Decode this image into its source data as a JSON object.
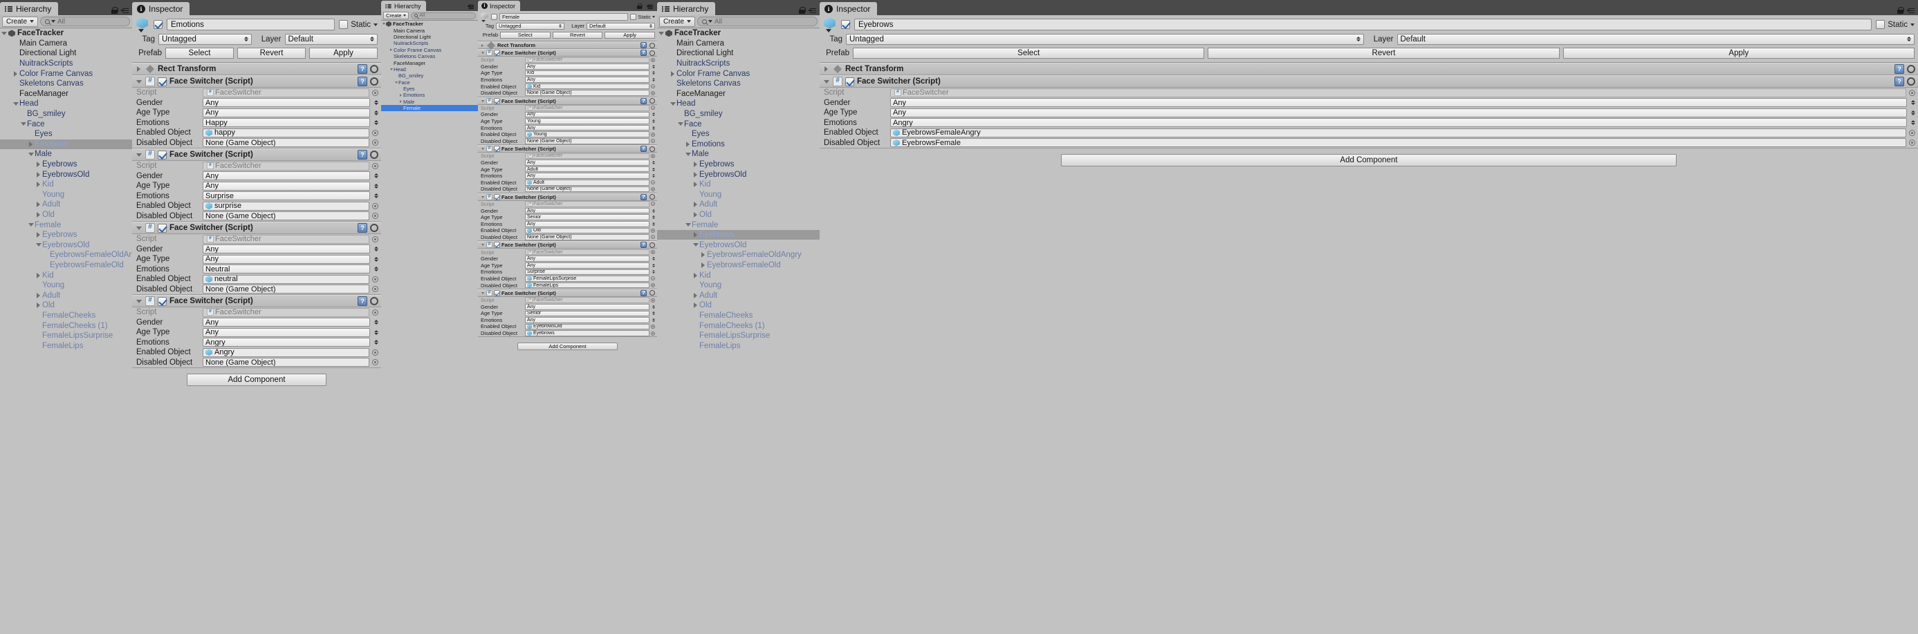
{
  "common": {
    "hierarchy_tab": "Hierarchy",
    "inspector_tab": "Inspector",
    "create_label": "Create",
    "search_placeholder": "All",
    "tag_label": "Tag",
    "layer_label": "Layer",
    "prefab_label": "Prefab",
    "static_label": "Static",
    "select_label": "Select",
    "revert_label": "Revert",
    "apply_label": "Apply",
    "rect_transform": "Rect Transform",
    "face_switcher": "Face Switcher (Script)",
    "add_component": "Add Component",
    "tag_value": "Untagged",
    "layer_value": "Default",
    "script_label": "Script",
    "script_value": "FaceSwitcher",
    "gender_label": "Gender",
    "age_label": "Age Type",
    "emotions_label": "Emotions",
    "enabled_label": "Enabled Object",
    "disabled_label": "Disabled Object",
    "none_game_object": "None (Game Object)",
    "accent_blue": "#3d7ddc",
    "panel_bg": "#c2c2c2"
  },
  "panel1": {
    "hierarchy": {
      "root": "FaceTracker",
      "items": [
        {
          "label": "Main Camera",
          "indent": 1,
          "arrow": "none",
          "style": "black"
        },
        {
          "label": "Directional Light",
          "indent": 1,
          "arrow": "none",
          "style": "black"
        },
        {
          "label": "NuitrackScripts",
          "indent": 1,
          "arrow": "none",
          "style": "blue"
        },
        {
          "label": "Color Frame Canvas",
          "indent": 1,
          "arrow": "right",
          "style": "blue"
        },
        {
          "label": "Skeletons Canvas",
          "indent": 1,
          "arrow": "none",
          "style": "blue"
        },
        {
          "label": "FaceManager",
          "indent": 1,
          "arrow": "none",
          "style": "black"
        },
        {
          "label": "Head",
          "indent": 1,
          "arrow": "down",
          "style": "blue"
        },
        {
          "label": "BG_smiley",
          "indent": 2,
          "arrow": "none",
          "style": "blue"
        },
        {
          "label": "Face",
          "indent": 2,
          "arrow": "down",
          "style": "blue"
        },
        {
          "label": "Eyes",
          "indent": 3,
          "arrow": "none",
          "style": "blue"
        },
        {
          "label": "Emotions",
          "indent": 3,
          "arrow": "right",
          "style": "selected"
        },
        {
          "label": "Male",
          "indent": 3,
          "arrow": "down",
          "style": "blue"
        },
        {
          "label": "Eyebrows",
          "indent": 4,
          "arrow": "right",
          "style": "blue"
        },
        {
          "label": "EyebrowsOld",
          "indent": 4,
          "arrow": "right",
          "style": "blue"
        },
        {
          "label": "Kid",
          "indent": 4,
          "arrow": "right",
          "style": "dim"
        },
        {
          "label": "Young",
          "indent": 4,
          "arrow": "none",
          "style": "dim"
        },
        {
          "label": "Adult",
          "indent": 4,
          "arrow": "right",
          "style": "dim"
        },
        {
          "label": "Old",
          "indent": 4,
          "arrow": "right",
          "style": "dim"
        },
        {
          "label": "Female",
          "indent": 3,
          "arrow": "down",
          "style": "dim"
        },
        {
          "label": "Eyebrows",
          "indent": 4,
          "arrow": "right",
          "style": "dim"
        },
        {
          "label": "EyebrowsOld",
          "indent": 4,
          "arrow": "down",
          "style": "dim"
        },
        {
          "label": "EyebrowsFemaleOldAngry",
          "indent": 5,
          "arrow": "none",
          "style": "dim"
        },
        {
          "label": "EyebrowsFemaleOld",
          "indent": 5,
          "arrow": "none",
          "style": "dim"
        },
        {
          "label": "Kid",
          "indent": 4,
          "arrow": "right",
          "style": "dim"
        },
        {
          "label": "Young",
          "indent": 4,
          "arrow": "none",
          "style": "dim"
        },
        {
          "label": "Adult",
          "indent": 4,
          "arrow": "right",
          "style": "dim"
        },
        {
          "label": "Old",
          "indent": 4,
          "arrow": "right",
          "style": "dim"
        },
        {
          "label": "FemaleCheeks",
          "indent": 4,
          "arrow": "none",
          "style": "dim"
        },
        {
          "label": "FemaleCheeks (1)",
          "indent": 4,
          "arrow": "none",
          "style": "dim"
        },
        {
          "label": "FemaleLipsSurprise",
          "indent": 4,
          "arrow": "none",
          "style": "dim"
        },
        {
          "label": "FemaleLips",
          "indent": 4,
          "arrow": "none",
          "style": "dim"
        }
      ]
    },
    "inspector": {
      "object_name": "Emotions",
      "enabled": true,
      "components": [
        {
          "title": "Face Switcher (Script)",
          "gender": "Any",
          "age": "Any",
          "emotions": "Happy",
          "enabled_object": "happy",
          "enabled_object_has_icon": true,
          "disabled_object": "None (Game Object)",
          "disabled_object_has_icon": false
        },
        {
          "title": "Face Switcher (Script)",
          "gender": "Any",
          "age": "Any",
          "emotions": "Surprise",
          "enabled_object": "surprise",
          "enabled_object_has_icon": true,
          "disabled_object": "None (Game Object)",
          "disabled_object_has_icon": false
        },
        {
          "title": "Face Switcher (Script)",
          "gender": "Any",
          "age": "Any",
          "emotions": "Neutral",
          "enabled_object": "neutral",
          "enabled_object_has_icon": true,
          "disabled_object": "None (Game Object)",
          "disabled_object_has_icon": false
        },
        {
          "title": "Face Switcher (Script)",
          "gender": "Any",
          "age": "Any",
          "emotions": "Angry",
          "enabled_object": "Angry",
          "enabled_object_has_icon": true,
          "disabled_object": "None (Game Object)",
          "disabled_object_has_icon": false
        }
      ]
    }
  },
  "panel2": {
    "hierarchy": {
      "root": "FaceTracker",
      "items": [
        {
          "label": "Main Camera",
          "indent": 1,
          "arrow": "none",
          "style": "black"
        },
        {
          "label": "Directional Light",
          "indent": 1,
          "arrow": "none",
          "style": "black"
        },
        {
          "label": "NuitrackScripts",
          "indent": 1,
          "arrow": "none",
          "style": "blue"
        },
        {
          "label": "Color Frame Canvas",
          "indent": 1,
          "arrow": "right",
          "style": "blue"
        },
        {
          "label": "Skeletons Canvas",
          "indent": 1,
          "arrow": "none",
          "style": "blue"
        },
        {
          "label": "FaceManager",
          "indent": 1,
          "arrow": "none",
          "style": "black"
        },
        {
          "label": "Head",
          "indent": 1,
          "arrow": "down",
          "style": "blue"
        },
        {
          "label": "BG_smiley",
          "indent": 2,
          "arrow": "none",
          "style": "blue"
        },
        {
          "label": "Face",
          "indent": 2,
          "arrow": "down",
          "style": "blue"
        },
        {
          "label": "Eyes",
          "indent": 3,
          "arrow": "none",
          "style": "blue"
        },
        {
          "label": "Emotions",
          "indent": 3,
          "arrow": "right",
          "style": "blue"
        },
        {
          "label": "Male",
          "indent": 3,
          "arrow": "right",
          "style": "blue"
        },
        {
          "label": "Female",
          "indent": 3,
          "arrow": "right",
          "style": "selected-blue"
        }
      ]
    },
    "inspector": {
      "object_name": "Female",
      "enabled": false,
      "components": [
        {
          "title": "Face Switcher (Script)",
          "gender": "Any",
          "age": "Kid",
          "emotions": "Any",
          "enabled_object": "Kid",
          "enabled_object_has_icon": true,
          "disabled_object": "None (Game Object)",
          "disabled_object_has_icon": false
        },
        {
          "title": "Face Switcher (Script)",
          "gender": "Any",
          "age": "Young",
          "emotions": "Any",
          "enabled_object": "Young",
          "enabled_object_has_icon": true,
          "disabled_object": "None (Game Object)",
          "disabled_object_has_icon": false
        },
        {
          "title": "Face Switcher (Script)",
          "gender": "Any",
          "age": "Adult",
          "emotions": "Any",
          "enabled_object": "Adult",
          "enabled_object_has_icon": true,
          "disabled_object": "None (Game Object)",
          "disabled_object_has_icon": false
        },
        {
          "title": "Face Switcher (Script)",
          "gender": "Any",
          "age": "Senior",
          "emotions": "Any",
          "enabled_object": "Old",
          "enabled_object_has_icon": true,
          "disabled_object": "None (Game Object)",
          "disabled_object_has_icon": false
        },
        {
          "title": "Face Switcher (Script)",
          "gender": "Any",
          "age": "Any",
          "emotions": "Surprise",
          "enabled_object": "FemaleLipsSurprise",
          "enabled_object_has_icon": true,
          "disabled_object": "FemaleLips",
          "disabled_object_has_icon": true
        },
        {
          "title": "Face Switcher (Script)",
          "gender": "Any",
          "age": "Senior",
          "emotions": "Any",
          "enabled_object": "EyebrowsOld",
          "enabled_object_has_icon": true,
          "disabled_object": "Eyebrows",
          "disabled_object_has_icon": true
        }
      ]
    }
  },
  "panel3": {
    "hierarchy": {
      "root": "FaceTracker",
      "items": [
        {
          "label": "Main Camera",
          "indent": 1,
          "arrow": "none",
          "style": "black"
        },
        {
          "label": "Directional Light",
          "indent": 1,
          "arrow": "none",
          "style": "black"
        },
        {
          "label": "NuitrackScripts",
          "indent": 1,
          "arrow": "none",
          "style": "blue"
        },
        {
          "label": "Color Frame Canvas",
          "indent": 1,
          "arrow": "right",
          "style": "blue"
        },
        {
          "label": "Skeletons Canvas",
          "indent": 1,
          "arrow": "none",
          "style": "blue"
        },
        {
          "label": "FaceManager",
          "indent": 1,
          "arrow": "none",
          "style": "black"
        },
        {
          "label": "Head",
          "indent": 1,
          "arrow": "down",
          "style": "blue"
        },
        {
          "label": "BG_smiley",
          "indent": 2,
          "arrow": "none",
          "style": "blue"
        },
        {
          "label": "Face",
          "indent": 2,
          "arrow": "down",
          "style": "blue"
        },
        {
          "label": "Eyes",
          "indent": 3,
          "arrow": "none",
          "style": "blue"
        },
        {
          "label": "Emotions",
          "indent": 3,
          "arrow": "right",
          "style": "blue"
        },
        {
          "label": "Male",
          "indent": 3,
          "arrow": "down",
          "style": "blue"
        },
        {
          "label": "Eyebrows",
          "indent": 4,
          "arrow": "right",
          "style": "blue"
        },
        {
          "label": "EyebrowsOld",
          "indent": 4,
          "arrow": "right",
          "style": "blue"
        },
        {
          "label": "Kid",
          "indent": 4,
          "arrow": "right",
          "style": "dim"
        },
        {
          "label": "Young",
          "indent": 4,
          "arrow": "none",
          "style": "dim"
        },
        {
          "label": "Adult",
          "indent": 4,
          "arrow": "right",
          "style": "dim"
        },
        {
          "label": "Old",
          "indent": 4,
          "arrow": "right",
          "style": "dim"
        },
        {
          "label": "Female",
          "indent": 3,
          "arrow": "down",
          "style": "dim"
        },
        {
          "label": "Eyebrows",
          "indent": 4,
          "arrow": "right",
          "style": "selected"
        },
        {
          "label": "EyebrowsOld",
          "indent": 4,
          "arrow": "down",
          "style": "dim"
        },
        {
          "label": "EyebrowsFemaleOldAngry",
          "indent": 5,
          "arrow": "right",
          "style": "dim"
        },
        {
          "label": "EyebrowsFemaleOld",
          "indent": 5,
          "arrow": "right",
          "style": "dim"
        },
        {
          "label": "Kid",
          "indent": 4,
          "arrow": "right",
          "style": "dim"
        },
        {
          "label": "Young",
          "indent": 4,
          "arrow": "none",
          "style": "dim"
        },
        {
          "label": "Adult",
          "indent": 4,
          "arrow": "right",
          "style": "dim"
        },
        {
          "label": "Old",
          "indent": 4,
          "arrow": "right",
          "style": "dim"
        },
        {
          "label": "FemaleCheeks",
          "indent": 4,
          "arrow": "none",
          "style": "dim"
        },
        {
          "label": "FemaleCheeks (1)",
          "indent": 4,
          "arrow": "none",
          "style": "dim"
        },
        {
          "label": "FemaleLipsSurprise",
          "indent": 4,
          "arrow": "none",
          "style": "dim"
        },
        {
          "label": "FemaleLips",
          "indent": 4,
          "arrow": "none",
          "style": "dim"
        }
      ]
    }
  },
  "panel4": {
    "inspector": {
      "object_name": "Eyebrows",
      "enabled": true,
      "components": [
        {
          "title": "Face Switcher (Script)",
          "gender": "Any",
          "age": "Any",
          "emotions": "Angry",
          "enabled_object": "EyebrowsFemaleAngry",
          "enabled_object_has_icon": true,
          "disabled_object": "EyebrowsFemale",
          "disabled_object_has_icon": true
        }
      ]
    }
  }
}
